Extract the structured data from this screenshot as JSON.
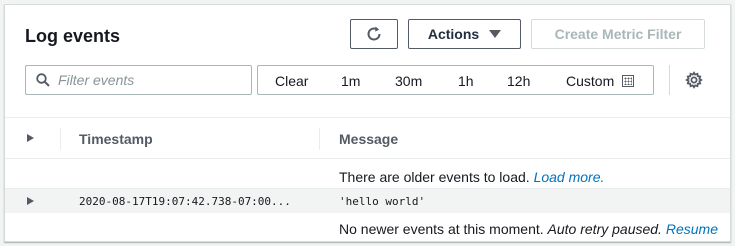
{
  "header": {
    "title": "Log events",
    "actions_label": "Actions",
    "create_metric_filter_label": "Create Metric Filter"
  },
  "filter": {
    "placeholder": "Filter events"
  },
  "time_range": {
    "options": [
      "Clear",
      "1m",
      "30m",
      "1h",
      "12h",
      "Custom"
    ]
  },
  "table": {
    "columns": [
      "Timestamp",
      "Message"
    ],
    "older_notice": "There are older events to load.",
    "load_more_label": "Load more.",
    "events": [
      {
        "timestamp": "2020-08-17T19:07:42.738-07:00...",
        "message": "'hello world'"
      }
    ],
    "newer_notice": "No newer events at this moment.",
    "auto_retry_text": "Auto retry paused.",
    "resume_label": "Resume"
  },
  "icons": {
    "refresh": "refresh-icon",
    "search": "search-icon",
    "calendar": "calendar-icon",
    "settings": "gear-icon",
    "expand": "caret-right-icon"
  },
  "colors": {
    "link": "#0073bb",
    "disabled_text": "#aab7b8",
    "border": "#aab7b8"
  }
}
